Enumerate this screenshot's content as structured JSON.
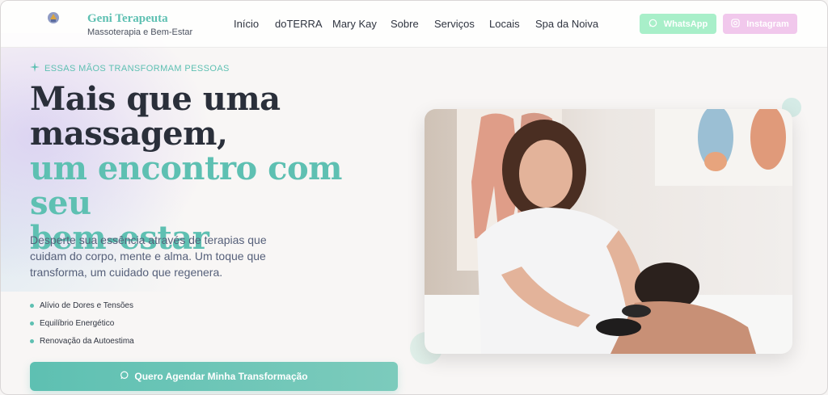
{
  "header": {
    "brand_name": "Geni Terapeuta",
    "brand_sub": "Massoterapia e Bem-Estar",
    "logo_icon": "emblem-icon",
    "nav": [
      "Início",
      "doTERRA",
      "Mary Kay",
      "Sobre",
      "Serviços",
      "Locais",
      "Spa da Noiva"
    ],
    "whatsapp_label": "WhatsApp",
    "instagram_label": "Instagram",
    "whatsapp_color": "#a8efc9",
    "instagram_color": "#f1c8ec"
  },
  "hero": {
    "tagline": "Essas mãos transformam pessoas",
    "tagline_icon": "sparkle-icon",
    "title_line1": "Mais que uma",
    "title_line2": "massagem,",
    "title_line3": "um encontro com seu",
    "title_line4": "bem-estar",
    "lead": "Desperte sua essência através de terapias que cuidam do corpo, mente e alma. Um toque que transforma, um cuidado que regenera.",
    "benefits": [
      "Alívio de Dores e Tensões",
      "Equilíbrio Energético",
      "Renovação da Autoestima"
    ],
    "cta_label": "Quero Agendar Minha Transformação",
    "cta_icon": "chat-bubble-icon",
    "accent_color": "#5ec0b2"
  }
}
